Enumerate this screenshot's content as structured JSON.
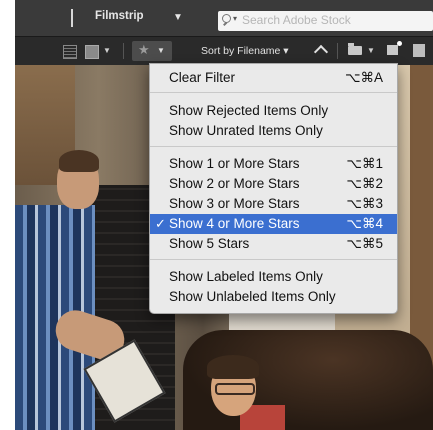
{
  "topbar": {
    "title": "Filmstrip",
    "title_caret": "▼",
    "search_placeholder": "Search Adobe Stock"
  },
  "filterbar": {
    "grid_caret": "▼",
    "star_glyph": "★",
    "star_caret": "▼",
    "sort_label": "Sort by Filename ▾",
    "folder_caret": "▼"
  },
  "menu": {
    "items": [
      {
        "label": "Clear Filter",
        "shortcut": "⌥⌘A"
      },
      {
        "label": "Show Rejected Items Only",
        "shortcut": ""
      },
      {
        "label": "Show Unrated Items Only",
        "shortcut": ""
      },
      {
        "label": "Show 1 or More Stars",
        "shortcut": "⌥⌘1"
      },
      {
        "label": "Show 2 or More Stars",
        "shortcut": "⌥⌘2"
      },
      {
        "label": "Show 3 or More Stars",
        "shortcut": "⌥⌘3"
      },
      {
        "label": "Show 4 or More Stars",
        "shortcut": "⌥⌘4",
        "checked": true,
        "check": "✓"
      },
      {
        "label": "Show 5 Stars",
        "shortcut": "⌥⌘5"
      },
      {
        "label": "Show Labeled Items Only",
        "shortcut": ""
      },
      {
        "label": "Show Unlabeled Items Only",
        "shortcut": ""
      }
    ]
  },
  "colors": {
    "toolbar": "#3a3a3a",
    "menu_bg": "#eaeaea",
    "selection": "#3b6fd0"
  }
}
